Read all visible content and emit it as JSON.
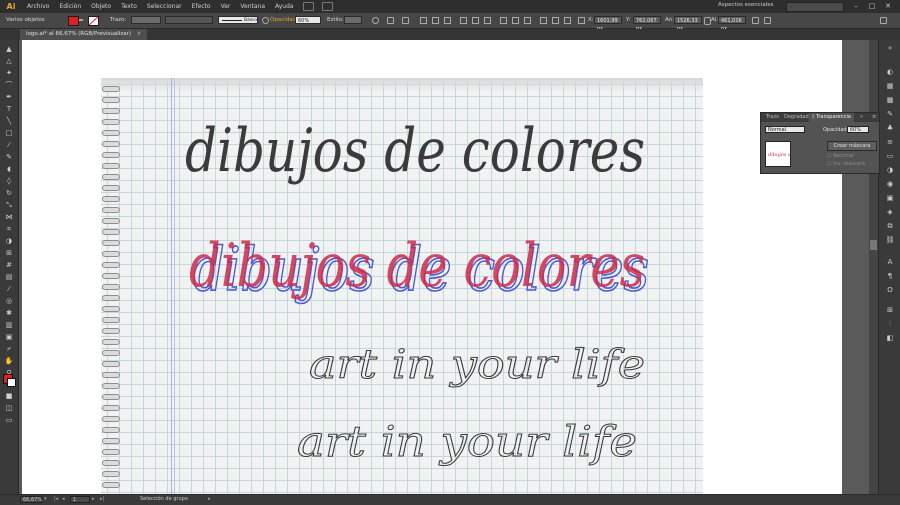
{
  "colors": {
    "accent": "#e8a330",
    "fill": "#e02020",
    "stroke_none": "#ffffff"
  },
  "menubar": {
    "app_logo": "Ai",
    "items": [
      "Archivo",
      "Edición",
      "Objeto",
      "Texto",
      "Seleccionar",
      "Efecto",
      "Ver",
      "Ventana",
      "Ayuda"
    ],
    "workspace": "Aspectos esenciales",
    "window_controls": [
      "–",
      "□",
      "✕"
    ]
  },
  "controlbar": {
    "selection_label": "Varios objetos",
    "stroke_label": "Trazo:",
    "brush_label": "Básico",
    "opacity_label": "Opacidad:",
    "opacity_value": "60%",
    "style_label": "Estilo:",
    "x_label": "X:",
    "x_value": "1601,99 px",
    "y_label": "Y:",
    "y_value": "762,067 px",
    "w_label": "An:",
    "w_value": "1526,33 px",
    "h_label": "Al:",
    "h_value": "461,016 px"
  },
  "document": {
    "tab_title": "logo.ai* al 66,67% (RGB/Previsualizar)"
  },
  "artwork": {
    "line1": "dibujos de colores",
    "line2": "dibujos de colores",
    "line3": "art in your life",
    "line4": "art in your life"
  },
  "panel": {
    "tabs": [
      "Trazo",
      "Degradado",
      "◊ Transparencia"
    ],
    "active_tab": 2,
    "blend_mode": "Normal",
    "opacity_label": "Opacidad:",
    "opacity_value": "60%",
    "make_mask_button": "Crear máscara",
    "clip_label": "Recortar",
    "invert_label": "Inv. máscara"
  },
  "statusbar": {
    "zoom": "66,67%",
    "page": "1",
    "tool_status": "Selección de grupo"
  }
}
